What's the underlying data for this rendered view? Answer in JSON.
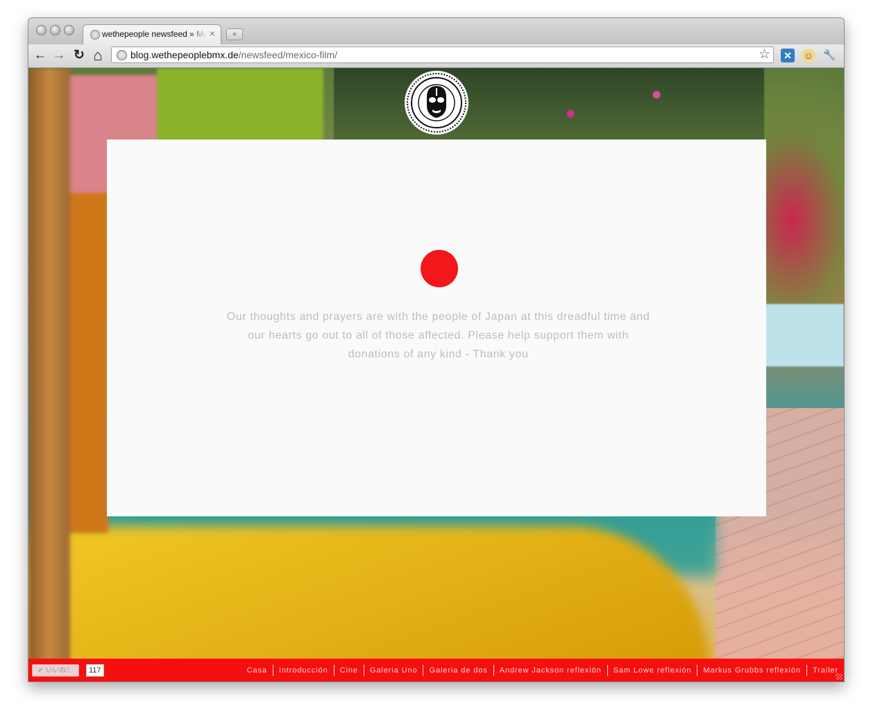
{
  "browser": {
    "tab_title": "wethepeople newsfeed » Mexico Film",
    "tab_close": "×",
    "new_tab": "+",
    "url_host": "blog.wethepeoplebmx.de",
    "url_path": "/newsfeed/mexico-film/",
    "nav_icons": {
      "back": "←",
      "forward": "→",
      "reload": "↻",
      "home": "⌂",
      "star": "☆",
      "ext1": "✕",
      "ext2": "☺",
      "wrench": "🔧"
    }
  },
  "page": {
    "message": "Our thoughts and prayers are with the people of Japan at this dreadful time and our hearts go out to all of those affected. Please help support them with donations of any kind - Thank you",
    "accent_color": "#f3161b",
    "footer_color": "#f50f0f"
  },
  "footer": {
    "like_label": "✔ いいね！",
    "like_count": "117",
    "nav": [
      "Casa",
      "Introducción",
      "Cine",
      "Galeria Uno",
      "Galeria de dos",
      "Andrew Jackson reflexión",
      "Sam Lowe reflexión",
      "Markus Grubbs reflexión",
      "Trailer"
    ]
  }
}
